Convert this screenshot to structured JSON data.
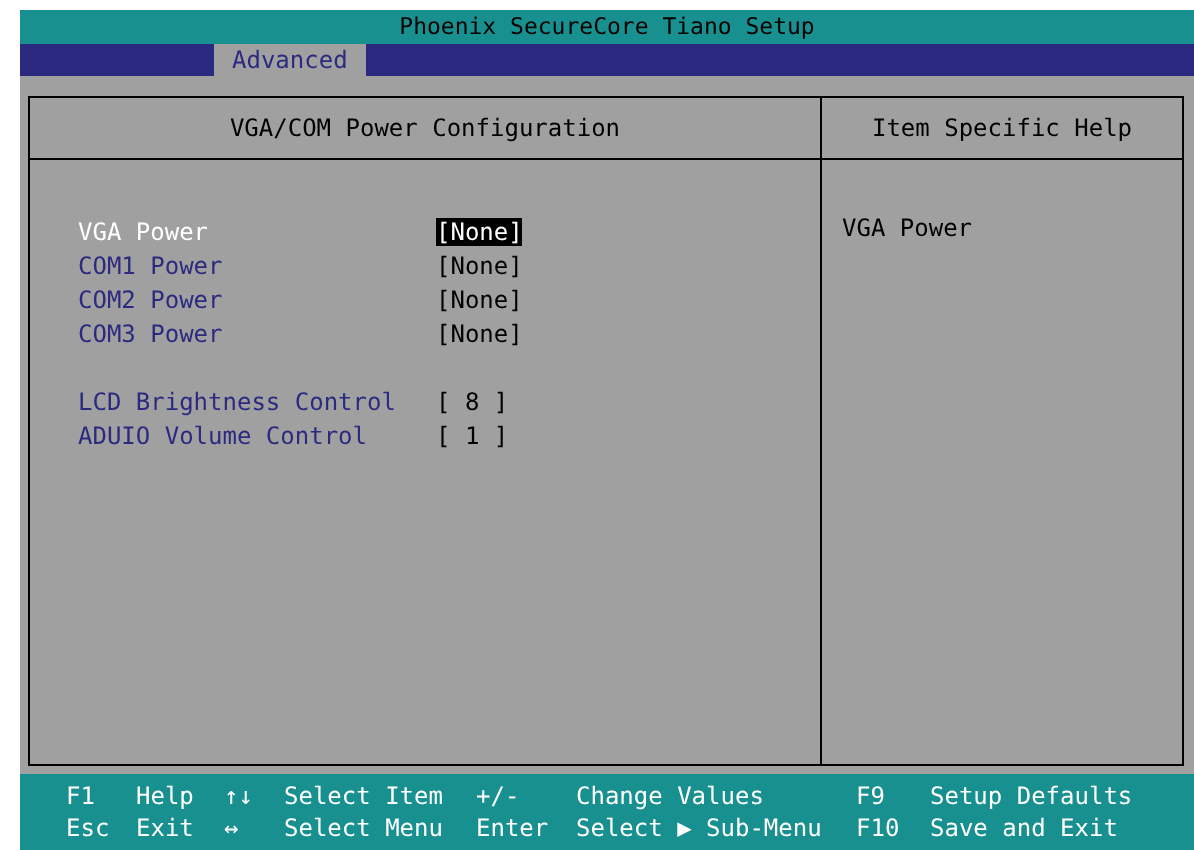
{
  "window": {
    "title": "Phoenix SecureCore Tiano Setup"
  },
  "tabs": [
    {
      "label": "Advanced",
      "selected": true
    }
  ],
  "panel": {
    "title": "VGA/COM Power Configuration",
    "groups": [
      [
        {
          "label": "VGA Power",
          "value": "[None]",
          "selected": true
        },
        {
          "label": "COM1 Power",
          "value": "[None]",
          "selected": false
        },
        {
          "label": "COM2 Power",
          "value": "[None]",
          "selected": false
        },
        {
          "label": "COM3 Power",
          "value": "[None]",
          "selected": false
        }
      ],
      [
        {
          "label": "LCD Brightness Control",
          "value": "[ 8 ]",
          "selected": false
        },
        {
          "label": "ADUIO Volume Control",
          "value": "[ 1 ]",
          "selected": false
        }
      ]
    ]
  },
  "help": {
    "title": "Item Specific Help",
    "text": "VGA Power"
  },
  "status_bar": [
    [
      {
        "key": "F1",
        "action": "Help"
      },
      {
        "key": "↑↓",
        "action": "Select Item"
      },
      {
        "key": "+/-",
        "action": "Change Values"
      },
      {
        "key": "F9",
        "action": "Setup Defaults"
      }
    ],
    [
      {
        "key": "Esc",
        "action": "Exit"
      },
      {
        "key": "↔",
        "action": "Select Menu"
      },
      {
        "key": "Enter",
        "action": "Select ▶ Sub-Menu"
      },
      {
        "key": "F10",
        "action": "Save and Exit"
      }
    ]
  ]
}
